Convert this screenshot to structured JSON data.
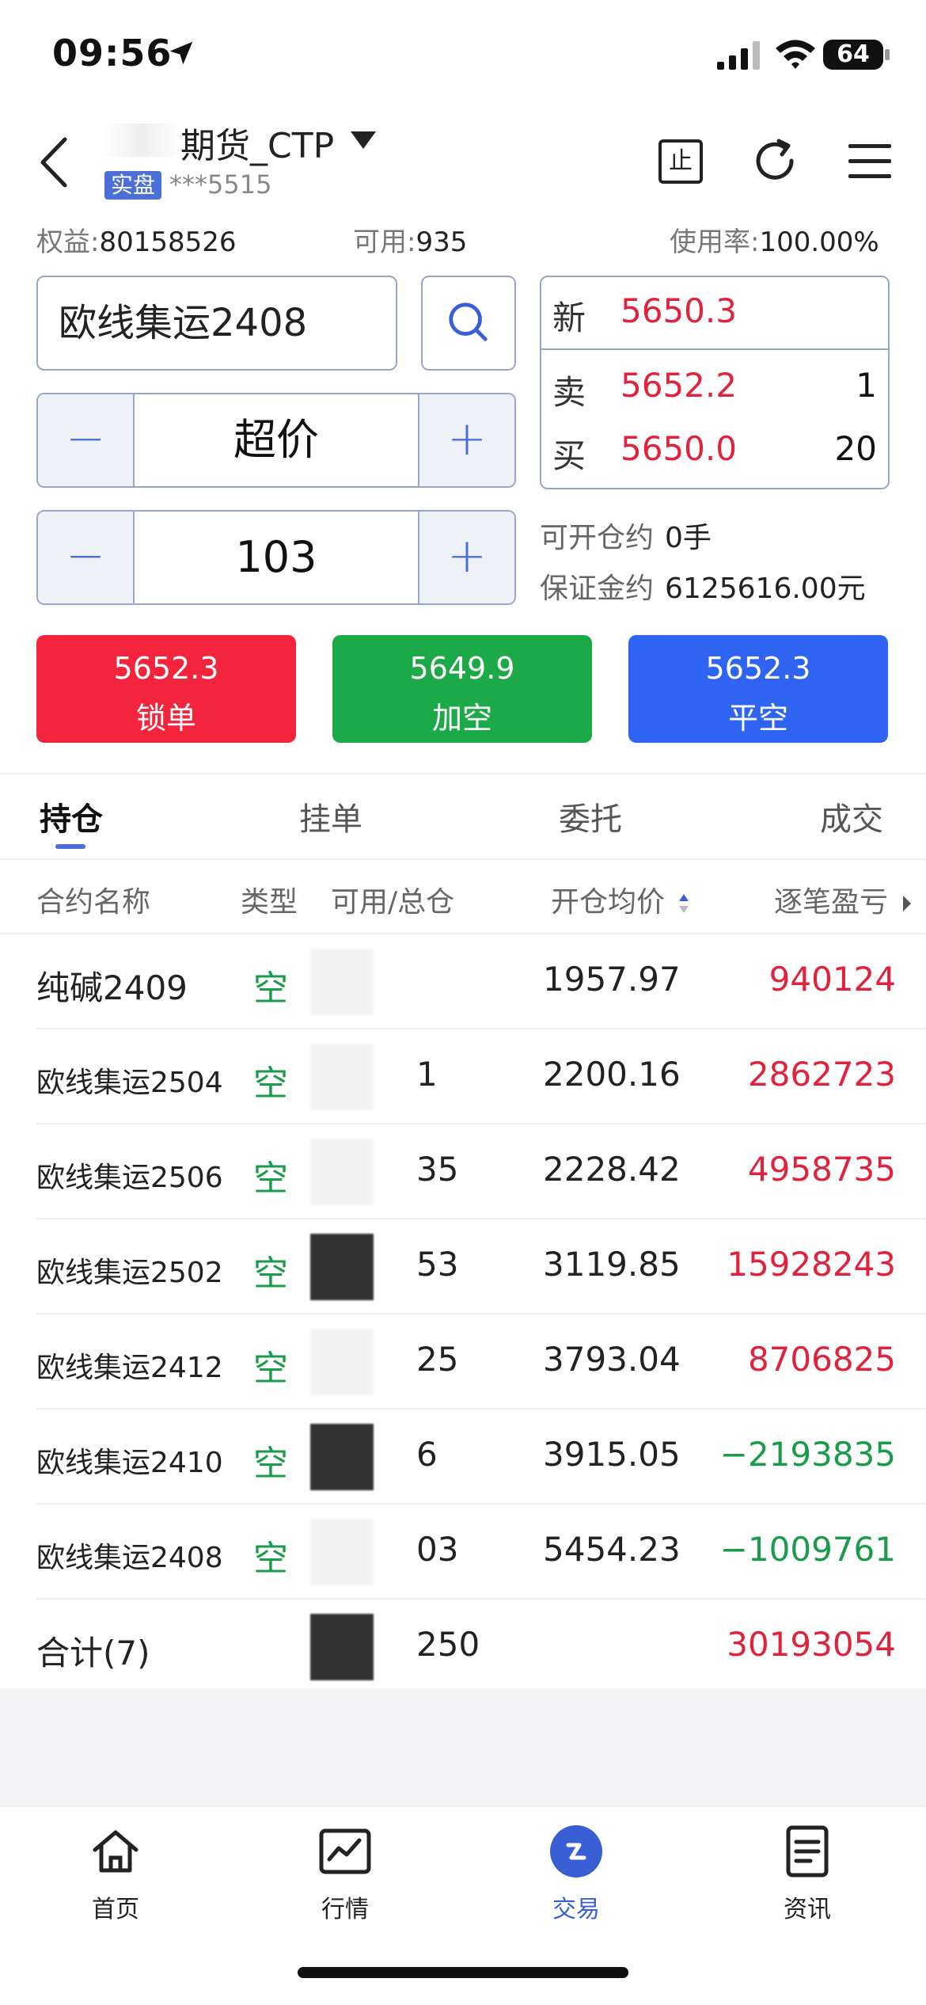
{
  "status": {
    "time": "09:56",
    "battery": "64"
  },
  "header": {
    "account_title": "期货_CTP",
    "live_badge": "实盘",
    "account_no": "***5515",
    "stop_label": "止"
  },
  "metrics": {
    "equity_label": "权益:",
    "equity_value": "80158526",
    "available_label": "可用:",
    "available_value": "935",
    "usage_label": "使用率:",
    "usage_value": "100.00%"
  },
  "order": {
    "contract": "欧线集运2408",
    "price_type": "超价",
    "quantity": "103",
    "minus": "−",
    "plus": "+"
  },
  "quote": {
    "last_label": "新",
    "last_price": "5650.3",
    "ask_label": "卖",
    "ask_price": "5652.2",
    "ask_vol": "1",
    "bid_label": "买",
    "bid_price": "5650.0",
    "bid_vol": "20"
  },
  "capacity": {
    "openable_label": "可开仓约",
    "openable_value": "0手",
    "margin_label": "保证金约",
    "margin_value": "6125616.00元"
  },
  "actions": [
    {
      "price": "5652.3",
      "label": "锁单",
      "color": "#f4243c"
    },
    {
      "price": "5649.9",
      "label": "加空",
      "color": "#1caa48"
    },
    {
      "price": "5652.3",
      "label": "平空",
      "color": "#2f63f2"
    }
  ],
  "tabs": [
    {
      "label": "持仓",
      "active": true
    },
    {
      "label": "挂单"
    },
    {
      "label": "委托"
    },
    {
      "label": "成交"
    }
  ],
  "table": {
    "headers": {
      "name": "合约名称",
      "type": "类型",
      "pos": "可用/总仓",
      "avg": "开仓均价",
      "pl": "逐笔盈亏"
    },
    "rows": [
      {
        "name": "纯碱2409",
        "type": "空",
        "pos": "",
        "avg": "1957.97",
        "pl": "940124",
        "dir": "up"
      },
      {
        "name": "欧线集运2504",
        "type": "空",
        "pos": "1",
        "avg": "2200.16",
        "pl": "2862723",
        "dir": "up"
      },
      {
        "name": "欧线集运2506",
        "type": "空",
        "pos": "35",
        "avg": "2228.42",
        "pl": "4958735",
        "dir": "up"
      },
      {
        "name": "欧线集运2502",
        "type": "空",
        "pos": "53",
        "avg": "3119.85",
        "pl": "15928243",
        "dir": "up"
      },
      {
        "name": "欧线集运2412",
        "type": "空",
        "pos": "25",
        "avg": "3793.04",
        "pl": "8706825",
        "dir": "up"
      },
      {
        "name": "欧线集运2410",
        "type": "空",
        "pos": "6",
        "avg": "3915.05",
        "pl": "−2193835",
        "dir": "down"
      },
      {
        "name": "欧线集运2408",
        "type": "空",
        "pos": "03",
        "avg": "5454.23",
        "pl": "−1009761",
        "dir": "down"
      }
    ],
    "total": {
      "label": "合计(7)",
      "pos": "250",
      "pl": "30193054"
    }
  },
  "nav": [
    {
      "label": "首页",
      "icon": "home-icon"
    },
    {
      "label": "行情",
      "icon": "chart-icon"
    },
    {
      "label": "交易",
      "icon": "trade-icon",
      "active": true
    },
    {
      "label": "资讯",
      "icon": "news-icon"
    }
  ]
}
